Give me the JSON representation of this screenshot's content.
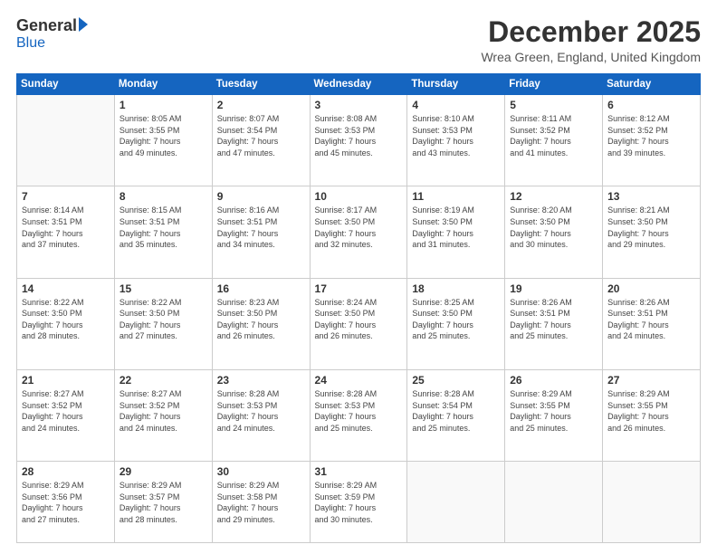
{
  "logo": {
    "general": "General",
    "blue": "Blue"
  },
  "header": {
    "month": "December 2025",
    "location": "Wrea Green, England, United Kingdom"
  },
  "days": [
    "Sunday",
    "Monday",
    "Tuesday",
    "Wednesday",
    "Thursday",
    "Friday",
    "Saturday"
  ],
  "weeks": [
    [
      {
        "day": "",
        "content": ""
      },
      {
        "day": "1",
        "content": "Sunrise: 8:05 AM\nSunset: 3:55 PM\nDaylight: 7 hours\nand 49 minutes."
      },
      {
        "day": "2",
        "content": "Sunrise: 8:07 AM\nSunset: 3:54 PM\nDaylight: 7 hours\nand 47 minutes."
      },
      {
        "day": "3",
        "content": "Sunrise: 8:08 AM\nSunset: 3:53 PM\nDaylight: 7 hours\nand 45 minutes."
      },
      {
        "day": "4",
        "content": "Sunrise: 8:10 AM\nSunset: 3:53 PM\nDaylight: 7 hours\nand 43 minutes."
      },
      {
        "day": "5",
        "content": "Sunrise: 8:11 AM\nSunset: 3:52 PM\nDaylight: 7 hours\nand 41 minutes."
      },
      {
        "day": "6",
        "content": "Sunrise: 8:12 AM\nSunset: 3:52 PM\nDaylight: 7 hours\nand 39 minutes."
      }
    ],
    [
      {
        "day": "7",
        "content": "Sunrise: 8:14 AM\nSunset: 3:51 PM\nDaylight: 7 hours\nand 37 minutes."
      },
      {
        "day": "8",
        "content": "Sunrise: 8:15 AM\nSunset: 3:51 PM\nDaylight: 7 hours\nand 35 minutes."
      },
      {
        "day": "9",
        "content": "Sunrise: 8:16 AM\nSunset: 3:51 PM\nDaylight: 7 hours\nand 34 minutes."
      },
      {
        "day": "10",
        "content": "Sunrise: 8:17 AM\nSunset: 3:50 PM\nDaylight: 7 hours\nand 32 minutes."
      },
      {
        "day": "11",
        "content": "Sunrise: 8:19 AM\nSunset: 3:50 PM\nDaylight: 7 hours\nand 31 minutes."
      },
      {
        "day": "12",
        "content": "Sunrise: 8:20 AM\nSunset: 3:50 PM\nDaylight: 7 hours\nand 30 minutes."
      },
      {
        "day": "13",
        "content": "Sunrise: 8:21 AM\nSunset: 3:50 PM\nDaylight: 7 hours\nand 29 minutes."
      }
    ],
    [
      {
        "day": "14",
        "content": "Sunrise: 8:22 AM\nSunset: 3:50 PM\nDaylight: 7 hours\nand 28 minutes."
      },
      {
        "day": "15",
        "content": "Sunrise: 8:22 AM\nSunset: 3:50 PM\nDaylight: 7 hours\nand 27 minutes."
      },
      {
        "day": "16",
        "content": "Sunrise: 8:23 AM\nSunset: 3:50 PM\nDaylight: 7 hours\nand 26 minutes."
      },
      {
        "day": "17",
        "content": "Sunrise: 8:24 AM\nSunset: 3:50 PM\nDaylight: 7 hours\nand 26 minutes."
      },
      {
        "day": "18",
        "content": "Sunrise: 8:25 AM\nSunset: 3:50 PM\nDaylight: 7 hours\nand 25 minutes."
      },
      {
        "day": "19",
        "content": "Sunrise: 8:26 AM\nSunset: 3:51 PM\nDaylight: 7 hours\nand 25 minutes."
      },
      {
        "day": "20",
        "content": "Sunrise: 8:26 AM\nSunset: 3:51 PM\nDaylight: 7 hours\nand 24 minutes."
      }
    ],
    [
      {
        "day": "21",
        "content": "Sunrise: 8:27 AM\nSunset: 3:52 PM\nDaylight: 7 hours\nand 24 minutes."
      },
      {
        "day": "22",
        "content": "Sunrise: 8:27 AM\nSunset: 3:52 PM\nDaylight: 7 hours\nand 24 minutes."
      },
      {
        "day": "23",
        "content": "Sunrise: 8:28 AM\nSunset: 3:53 PM\nDaylight: 7 hours\nand 24 minutes."
      },
      {
        "day": "24",
        "content": "Sunrise: 8:28 AM\nSunset: 3:53 PM\nDaylight: 7 hours\nand 25 minutes."
      },
      {
        "day": "25",
        "content": "Sunrise: 8:28 AM\nSunset: 3:54 PM\nDaylight: 7 hours\nand 25 minutes."
      },
      {
        "day": "26",
        "content": "Sunrise: 8:29 AM\nSunset: 3:55 PM\nDaylight: 7 hours\nand 25 minutes."
      },
      {
        "day": "27",
        "content": "Sunrise: 8:29 AM\nSunset: 3:55 PM\nDaylight: 7 hours\nand 26 minutes."
      }
    ],
    [
      {
        "day": "28",
        "content": "Sunrise: 8:29 AM\nSunset: 3:56 PM\nDaylight: 7 hours\nand 27 minutes."
      },
      {
        "day": "29",
        "content": "Sunrise: 8:29 AM\nSunset: 3:57 PM\nDaylight: 7 hours\nand 28 minutes."
      },
      {
        "day": "30",
        "content": "Sunrise: 8:29 AM\nSunset: 3:58 PM\nDaylight: 7 hours\nand 29 minutes."
      },
      {
        "day": "31",
        "content": "Sunrise: 8:29 AM\nSunset: 3:59 PM\nDaylight: 7 hours\nand 30 minutes."
      },
      {
        "day": "",
        "content": ""
      },
      {
        "day": "",
        "content": ""
      },
      {
        "day": "",
        "content": ""
      }
    ]
  ]
}
